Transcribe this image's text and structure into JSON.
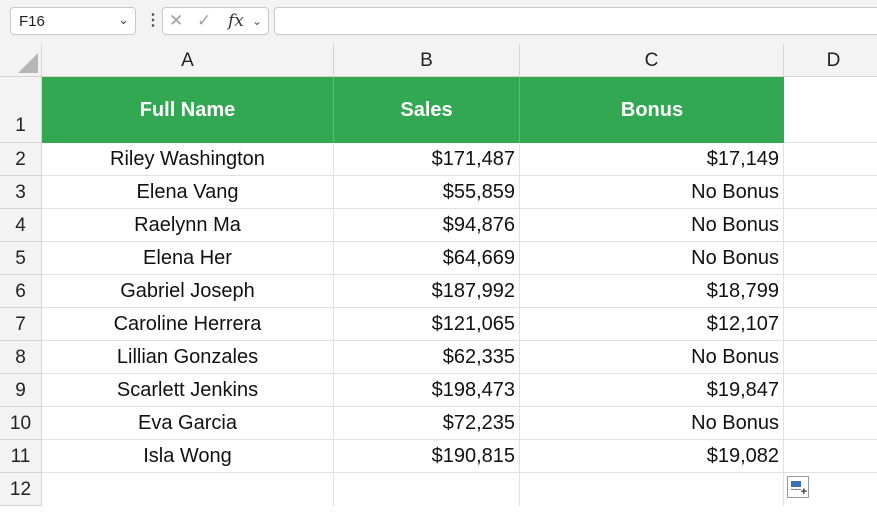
{
  "formula_bar": {
    "name_box": "F16",
    "formula": "",
    "fx_label": "fx"
  },
  "columns": [
    "A",
    "B",
    "C",
    "D"
  ],
  "row_numbers": [
    "1",
    "2",
    "3",
    "4",
    "5",
    "6",
    "7",
    "8",
    "9",
    "10",
    "11",
    "12"
  ],
  "table": {
    "headers": [
      "Full Name",
      "Sales",
      "Bonus"
    ],
    "header_color": "#33a853",
    "rows": [
      [
        "Riley Washington",
        "$171,487",
        "$17,149"
      ],
      [
        "Elena Vang",
        "$55,859",
        "No Bonus"
      ],
      [
        "Raelynn Ma",
        "$94,876",
        "No Bonus"
      ],
      [
        "Elena Her",
        "$64,669",
        "No Bonus"
      ],
      [
        "Gabriel Joseph",
        "$187,992",
        "$18,799"
      ],
      [
        "Caroline Herrera",
        "$121,065",
        "$12,107"
      ],
      [
        "Lillian Gonzales",
        "$62,335",
        "No Bonus"
      ],
      [
        "Scarlett Jenkins",
        "$198,473",
        "$19,847"
      ],
      [
        "Eva Garcia",
        "$72,235",
        "No Bonus"
      ],
      [
        "Isla Wong",
        "$190,815",
        "$19,082"
      ]
    ]
  },
  "icons": {
    "name_box_dropdown": "chevron-down-icon",
    "more_options": "vertical-ellipsis-icon",
    "cancel": "cancel-x-icon",
    "enter": "checkmark-icon",
    "insert_function": "fx-icon",
    "quick_analysis": "quick-analysis-icon",
    "select_all": "select-all-icon"
  }
}
